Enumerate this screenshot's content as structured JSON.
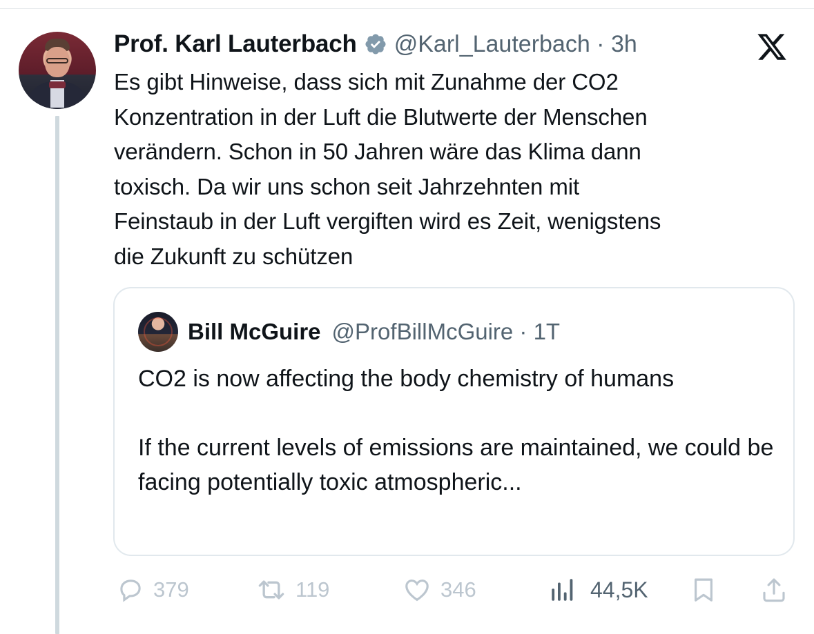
{
  "tweet": {
    "author_name": "Prof. Karl Lauterbach",
    "handle_time": "@Karl_Lauterbach · 3h",
    "text": "Es gibt Hinweise, dass sich mit Zunahme der CO2\nKonzentration in der Luft die Blutwerte der Menschen\nverändern. Schon in 50 Jahren wäre das Klima dann\ntoxisch. Da wir uns schon seit Jahrzehnten mit\nFeinstaub in der Luft vergiften wird es Zeit, wenigstens\ndie Zukunft zu schützen"
  },
  "quote": {
    "author_name": "Bill McGuire",
    "handle_time": "@ProfBillMcGuire · 1T",
    "paragraph_1": "CO2 is now affecting the body chemistry of humans",
    "paragraph_2": "If the current levels of emissions are maintained, we could be facing potentially toxic atmospheric..."
  },
  "actions": {
    "replies": "379",
    "reposts": "119",
    "likes": "346",
    "views": "44,5K"
  },
  "icons": {
    "verified": "verified-badge-icon",
    "brand": "x-logo-icon",
    "reply": "reply-icon",
    "repost": "repost-icon",
    "like": "heart-icon",
    "views": "views-chart-icon",
    "bookmark": "bookmark-icon",
    "share": "share-icon"
  },
  "colors": {
    "text": "#0f1419",
    "secondary": "#536471",
    "muted_action": "#bcc6cf",
    "border": "#e1e8ed",
    "thread_line": "#cfd9de",
    "verified_badge": "#829aab"
  }
}
